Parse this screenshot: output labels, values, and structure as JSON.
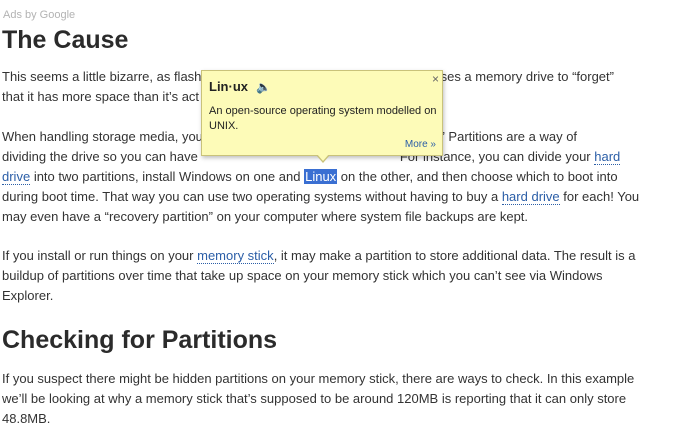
{
  "ads_label": "Ads by Google",
  "section1": {
    "heading": "The Cause",
    "p1": {
      "a": "This seems a little bizarre, as flash",
      "b": "t causes a memory drive to “forget”",
      "c": "that it has more space than it’s act"
    },
    "p2": {
      "a": "When handling storage media, you",
      "b": "ons.” Partitions are a way of",
      "c": "dividing the drive so you can have",
      "d": "For instance, you can divide your",
      "link_hard_drive_1": "hard drive",
      "e": "into two partitions, install Windows on one and",
      "highlight": "Linux",
      "f": "on the other, and then choose which to boot into during boot time. That way you can use two operating systems without having to buy a",
      "link_hard_drive_2": "hard drive",
      "g": "for each! You may even have a “recovery partition” on your computer where system file backups are kept."
    },
    "p3": {
      "a": "If you install or run things on your",
      "link_memory_stick": "memory stick",
      "b": ", it may make a partition to store additional data. The result is a buildup of partitions over time that take up space on your memory stick which you can’t see via Windows Explorer."
    }
  },
  "section2": {
    "heading": "Checking for Partitions",
    "p4": "If you suspect there might be hidden partitions on your memory stick, there are ways to check. In this example we’ll be looking at why a memory stick that’s supposed to be around 120MB is reporting that it can only store 48.8MB."
  },
  "popup": {
    "word": "Lin·ux",
    "speaker_icon": "speaker-icon",
    "definition": "An open-source operating system modelled on UNIX.",
    "more_label": "More »",
    "close_label": "×"
  },
  "colors": {
    "link": "#2b5ea7",
    "highlight": "#3a6fd2",
    "popup_bg": "#fdfbb8"
  }
}
